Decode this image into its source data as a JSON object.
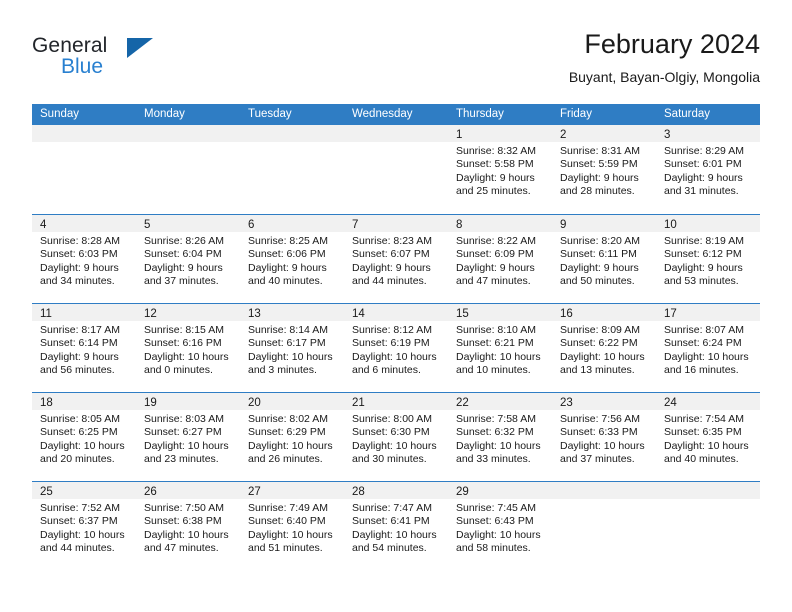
{
  "brand": {
    "word_one": "General",
    "word_two": "Blue",
    "logo_icon": "triangle-logo-icon",
    "accent_color": "#2980d0",
    "logo_color": "#1565a8"
  },
  "header": {
    "title": "February 2024",
    "subtitle": "Buyant, Bayan-Olgiy, Mongolia"
  },
  "calendar": {
    "header_bg": "#2f7dc4",
    "day_band_bg": "#f1f1f1",
    "weekdays": [
      "Sunday",
      "Monday",
      "Tuesday",
      "Wednesday",
      "Thursday",
      "Friday",
      "Saturday"
    ],
    "weeks": [
      [
        {
          "day": "",
          "lines": []
        },
        {
          "day": "",
          "lines": []
        },
        {
          "day": "",
          "lines": []
        },
        {
          "day": "",
          "lines": []
        },
        {
          "day": "1",
          "lines": [
            "Sunrise: 8:32 AM",
            "Sunset: 5:58 PM",
            "Daylight: 9 hours",
            "and 25 minutes."
          ]
        },
        {
          "day": "2",
          "lines": [
            "Sunrise: 8:31 AM",
            "Sunset: 5:59 PM",
            "Daylight: 9 hours",
            "and 28 minutes."
          ]
        },
        {
          "day": "3",
          "lines": [
            "Sunrise: 8:29 AM",
            "Sunset: 6:01 PM",
            "Daylight: 9 hours",
            "and 31 minutes."
          ]
        }
      ],
      [
        {
          "day": "4",
          "lines": [
            "Sunrise: 8:28 AM",
            "Sunset: 6:03 PM",
            "Daylight: 9 hours",
            "and 34 minutes."
          ]
        },
        {
          "day": "5",
          "lines": [
            "Sunrise: 8:26 AM",
            "Sunset: 6:04 PM",
            "Daylight: 9 hours",
            "and 37 minutes."
          ]
        },
        {
          "day": "6",
          "lines": [
            "Sunrise: 8:25 AM",
            "Sunset: 6:06 PM",
            "Daylight: 9 hours",
            "and 40 minutes."
          ]
        },
        {
          "day": "7",
          "lines": [
            "Sunrise: 8:23 AM",
            "Sunset: 6:07 PM",
            "Daylight: 9 hours",
            "and 44 minutes."
          ]
        },
        {
          "day": "8",
          "lines": [
            "Sunrise: 8:22 AM",
            "Sunset: 6:09 PM",
            "Daylight: 9 hours",
            "and 47 minutes."
          ]
        },
        {
          "day": "9",
          "lines": [
            "Sunrise: 8:20 AM",
            "Sunset: 6:11 PM",
            "Daylight: 9 hours",
            "and 50 minutes."
          ]
        },
        {
          "day": "10",
          "lines": [
            "Sunrise: 8:19 AM",
            "Sunset: 6:12 PM",
            "Daylight: 9 hours",
            "and 53 minutes."
          ]
        }
      ],
      [
        {
          "day": "11",
          "lines": [
            "Sunrise: 8:17 AM",
            "Sunset: 6:14 PM",
            "Daylight: 9 hours",
            "and 56 minutes."
          ]
        },
        {
          "day": "12",
          "lines": [
            "Sunrise: 8:15 AM",
            "Sunset: 6:16 PM",
            "Daylight: 10 hours",
            "and 0 minutes."
          ]
        },
        {
          "day": "13",
          "lines": [
            "Sunrise: 8:14 AM",
            "Sunset: 6:17 PM",
            "Daylight: 10 hours",
            "and 3 minutes."
          ]
        },
        {
          "day": "14",
          "lines": [
            "Sunrise: 8:12 AM",
            "Sunset: 6:19 PM",
            "Daylight: 10 hours",
            "and 6 minutes."
          ]
        },
        {
          "day": "15",
          "lines": [
            "Sunrise: 8:10 AM",
            "Sunset: 6:21 PM",
            "Daylight: 10 hours",
            "and 10 minutes."
          ]
        },
        {
          "day": "16",
          "lines": [
            "Sunrise: 8:09 AM",
            "Sunset: 6:22 PM",
            "Daylight: 10 hours",
            "and 13 minutes."
          ]
        },
        {
          "day": "17",
          "lines": [
            "Sunrise: 8:07 AM",
            "Sunset: 6:24 PM",
            "Daylight: 10 hours",
            "and 16 minutes."
          ]
        }
      ],
      [
        {
          "day": "18",
          "lines": [
            "Sunrise: 8:05 AM",
            "Sunset: 6:25 PM",
            "Daylight: 10 hours",
            "and 20 minutes."
          ]
        },
        {
          "day": "19",
          "lines": [
            "Sunrise: 8:03 AM",
            "Sunset: 6:27 PM",
            "Daylight: 10 hours",
            "and 23 minutes."
          ]
        },
        {
          "day": "20",
          "lines": [
            "Sunrise: 8:02 AM",
            "Sunset: 6:29 PM",
            "Daylight: 10 hours",
            "and 26 minutes."
          ]
        },
        {
          "day": "21",
          "lines": [
            "Sunrise: 8:00 AM",
            "Sunset: 6:30 PM",
            "Daylight: 10 hours",
            "and 30 minutes."
          ]
        },
        {
          "day": "22",
          "lines": [
            "Sunrise: 7:58 AM",
            "Sunset: 6:32 PM",
            "Daylight: 10 hours",
            "and 33 minutes."
          ]
        },
        {
          "day": "23",
          "lines": [
            "Sunrise: 7:56 AM",
            "Sunset: 6:33 PM",
            "Daylight: 10 hours",
            "and 37 minutes."
          ]
        },
        {
          "day": "24",
          "lines": [
            "Sunrise: 7:54 AM",
            "Sunset: 6:35 PM",
            "Daylight: 10 hours",
            "and 40 minutes."
          ]
        }
      ],
      [
        {
          "day": "25",
          "lines": [
            "Sunrise: 7:52 AM",
            "Sunset: 6:37 PM",
            "Daylight: 10 hours",
            "and 44 minutes."
          ]
        },
        {
          "day": "26",
          "lines": [
            "Sunrise: 7:50 AM",
            "Sunset: 6:38 PM",
            "Daylight: 10 hours",
            "and 47 minutes."
          ]
        },
        {
          "day": "27",
          "lines": [
            "Sunrise: 7:49 AM",
            "Sunset: 6:40 PM",
            "Daylight: 10 hours",
            "and 51 minutes."
          ]
        },
        {
          "day": "28",
          "lines": [
            "Sunrise: 7:47 AM",
            "Sunset: 6:41 PM",
            "Daylight: 10 hours",
            "and 54 minutes."
          ]
        },
        {
          "day": "29",
          "lines": [
            "Sunrise: 7:45 AM",
            "Sunset: 6:43 PM",
            "Daylight: 10 hours",
            "and 58 minutes."
          ]
        },
        {
          "day": "",
          "lines": []
        },
        {
          "day": "",
          "lines": []
        }
      ]
    ]
  }
}
